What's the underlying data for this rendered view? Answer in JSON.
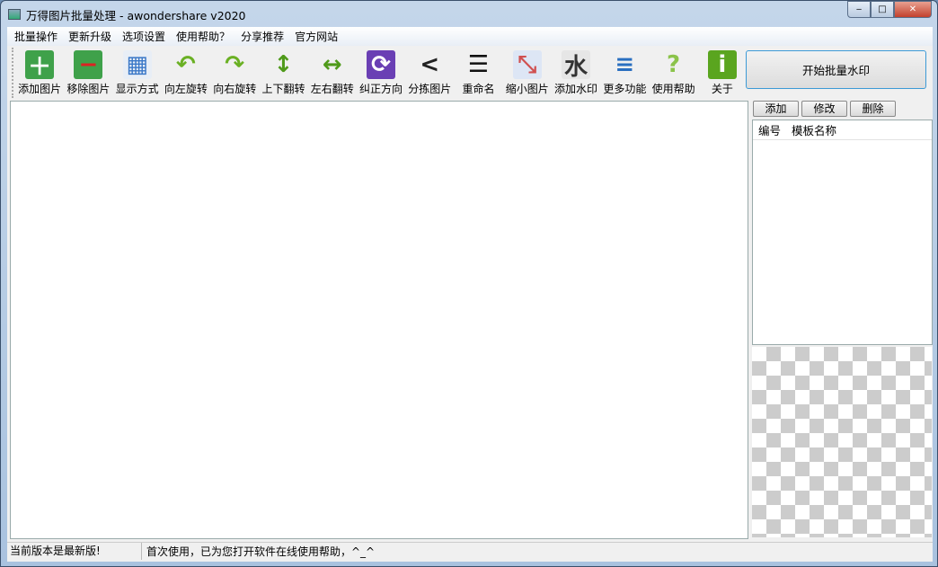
{
  "window": {
    "title": "万得图片批量处理 - awondershare v2020",
    "minimize": "‒",
    "maximize": "□",
    "close": "✕"
  },
  "menu": [
    "批量操作",
    "更新升级",
    "选项设置",
    "使用帮助？",
    "分享推荐",
    "官方网站"
  ],
  "toolbar": [
    {
      "label": "添加图片",
      "icon": "add-image-icon",
      "glyph": "＋",
      "bg": "#3fa14a",
      "fg": "#fff"
    },
    {
      "label": "移除图片",
      "icon": "remove-image-icon",
      "glyph": "−",
      "bg": "#3fa14a",
      "fg": "#d22"
    },
    {
      "label": "显示方式",
      "icon": "grid-view-icon",
      "glyph": "▦",
      "bg": "#e8eef6",
      "fg": "#3a78c8"
    },
    {
      "label": "向左旋转",
      "icon": "rotate-left-icon",
      "glyph": "↶",
      "bg": "transparent",
      "fg": "#6ab023"
    },
    {
      "label": "向右旋转",
      "icon": "rotate-right-icon",
      "glyph": "↷",
      "bg": "transparent",
      "fg": "#6ab023"
    },
    {
      "label": "上下翻转",
      "icon": "flip-vertical-icon",
      "glyph": "↕",
      "bg": "transparent",
      "fg": "#4f9a1a"
    },
    {
      "label": "左右翻转",
      "icon": "flip-horizontal-icon",
      "glyph": "↔",
      "bg": "transparent",
      "fg": "#4f9a1a"
    },
    {
      "label": "纠正方向",
      "icon": "correct-orientation-icon",
      "glyph": "⟳",
      "bg": "#6a3fb4",
      "fg": "#fff"
    },
    {
      "label": "分拣图片",
      "icon": "share-sort-icon",
      "glyph": "<",
      "bg": "transparent",
      "fg": "#222"
    },
    {
      "label": "重命名",
      "icon": "numbered-list-icon",
      "glyph": "☰",
      "bg": "transparent",
      "fg": "#111"
    },
    {
      "label": "缩小图片",
      "icon": "shrink-icon",
      "glyph": "⤡",
      "bg": "#dde6f5",
      "fg": "#d05050"
    },
    {
      "label": "添加水印",
      "icon": "watermark-icon",
      "glyph": "水",
      "bg": "#e6e6e6",
      "fg": "#333"
    },
    {
      "label": "更多功能",
      "icon": "more-features-icon",
      "glyph": "≡",
      "bg": "transparent",
      "fg": "#2a6fc0"
    },
    {
      "label": "使用帮助",
      "icon": "help-icon",
      "glyph": "?",
      "bg": "transparent",
      "fg": "#8bc34a"
    },
    {
      "label": "关于",
      "icon": "about-icon",
      "glyph": "i",
      "bg": "#5aa51f",
      "fg": "#fff"
    }
  ],
  "start_button": "开始批量水印",
  "template_panel": {
    "add": "添加",
    "edit": "修改",
    "delete": "删除",
    "columns": [
      "编号",
      "模板名称"
    ]
  },
  "status": {
    "version": "当前版本是最新版!",
    "message": "首次使用，已为您打开软件在线使用帮助，^_^"
  }
}
